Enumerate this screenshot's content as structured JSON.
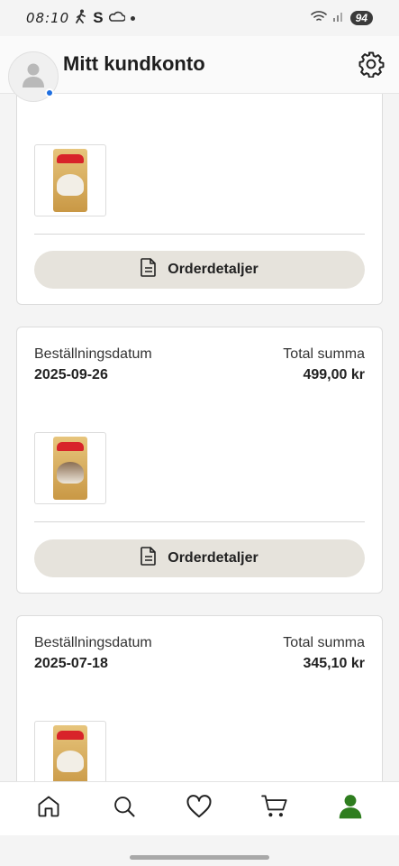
{
  "status_bar": {
    "time": "08:10",
    "battery": "94",
    "icons": [
      "walking-icon",
      "s-icon",
      "cloud-icon",
      "dot-icon",
      "wifi-icon",
      "signal-icon"
    ]
  },
  "header": {
    "title": "Mitt kundkonto",
    "avatar_icon": "user-avatar-icon",
    "settings_icon": "gear-icon"
  },
  "orders": [
    {
      "date_label": "",
      "date": "",
      "total_label": "",
      "total": "",
      "details_button": "Orderdetaljer",
      "product_image": "royal-canin-bag"
    },
    {
      "date_label": "Beställningsdatum",
      "date": "2025-09-26",
      "total_label": "Total summa",
      "total": "499,00 kr",
      "details_button": "Orderdetaljer",
      "product_image": "royal-canin-bag"
    },
    {
      "date_label": "Beställningsdatum",
      "date": "2025-07-18",
      "total_label": "Total summa",
      "total": "345,10 kr",
      "details_button": "",
      "product_image": "royal-canin-bag"
    }
  ],
  "bottom_nav": [
    {
      "name": "home",
      "icon": "home-icon",
      "active": false
    },
    {
      "name": "search",
      "icon": "search-icon",
      "active": false
    },
    {
      "name": "favorites",
      "icon": "heart-icon",
      "active": false
    },
    {
      "name": "cart",
      "icon": "cart-icon",
      "active": false
    },
    {
      "name": "account",
      "icon": "user-icon",
      "active": true
    }
  ],
  "colors": {
    "accent_green": "#2e7d1e",
    "button_bg": "#e6e3dc",
    "badge_blue": "#1f6fe0"
  }
}
